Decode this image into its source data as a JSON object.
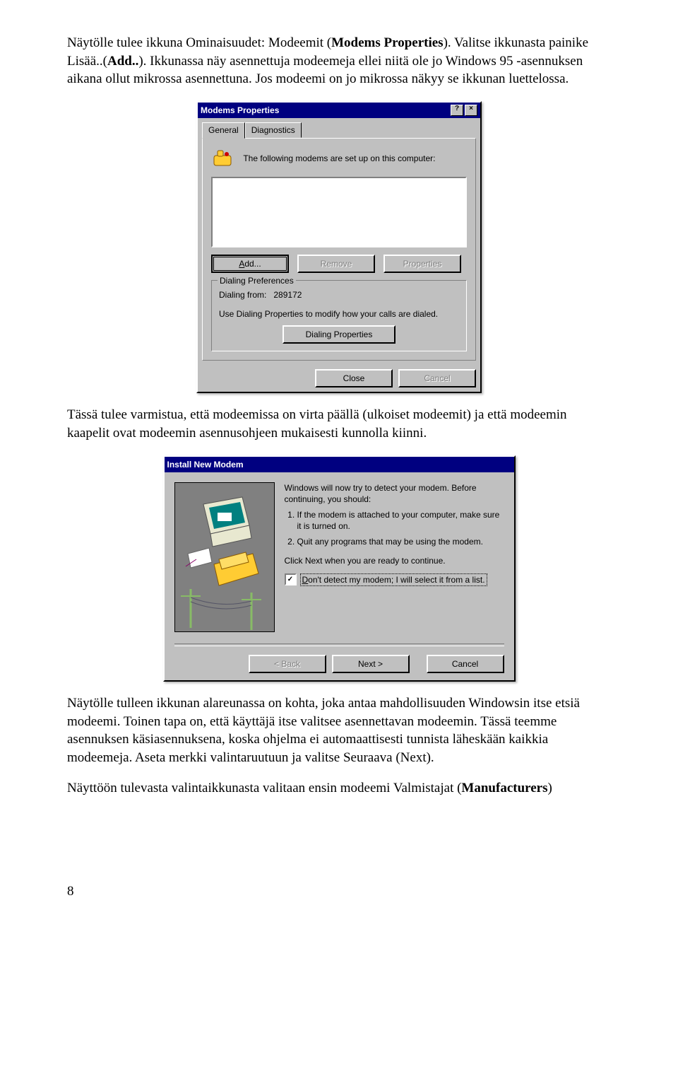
{
  "para1a": "Näytölle tulee ikkuna Ominaisuudet: Modeemit (",
  "para1b": "Modems Properties",
  "para1c": "). Valitse ikkunasta painike Lisää..(",
  "para1d": "Add..",
  "para1e": "). Ikkunassa näy asennettuja modeemeja ellei niitä ole jo Windows 95 -asennuksen aikana ollut mikrossa asennettuna. Jos modeemi on jo mikrossa näkyy se ikkunan luettelossa.",
  "dlg1": {
    "title": "Modems Properties",
    "tab1": "General",
    "tab2": "Diagnostics",
    "desc": "The following modems are set up on this computer:",
    "add": "Add...",
    "remove": "Remove",
    "props": "Properties",
    "grp": "Dialing Preferences",
    "from_lbl": "Dialing from:",
    "from_val": "289172",
    "pref_txt": "Use Dialing Properties to modify how your calls are dialed.",
    "dial_btn": "Dialing Properties",
    "close": "Close",
    "cancel": "Cancel"
  },
  "para2": "Tässä  tulee varmistua, että modeemissa on virta päällä (ulkoiset modeemit) ja että modeemin kaapelit ovat modeemin asennusohjeen mukaisesti kunnolla kiinni.",
  "dlg2": {
    "title": "Install New Modem",
    "intro": "Windows will now try to detect your modem.  Before continuing, you should:",
    "li1": "If the modem is attached to your computer, make sure it is turned on.",
    "li2": "Quit any programs that may be using the modem.",
    "cont": "Click Next when you are ready to continue.",
    "chk": "Don't detect my modem; I will select it from a list.",
    "back": "< Back",
    "next": "Next >",
    "cancel": "Cancel"
  },
  "para3": "Näytölle tulleen ikkunan alareunassa on kohta, joka antaa mahdollisuuden Windowsin itse etsiä modeemi. Toinen tapa on, että käyttäjä itse valitsee asennettavan modeemin. Tässä teemme asennuksen käsiasennuksena, koska ohjelma ei automaattisesti tunnista läheskään kaikkia modeemeja.  Aseta merkki valintaruutuun ja valitse Seuraava (Next).",
  "para4a": "Näyttöön tulevasta valintaikkunasta valitaan ensin modeemi Valmistajat (",
  "para4b": "Manufacturers",
  "para4c": ")",
  "pagenum": "8"
}
